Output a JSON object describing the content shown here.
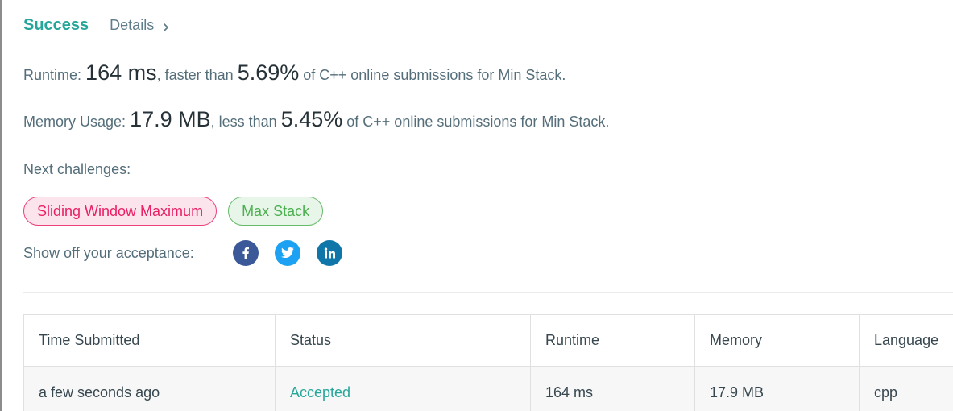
{
  "header": {
    "status_title": "Success",
    "details_label": "Details",
    "details_icon": "chevron-right-icon"
  },
  "runtime": {
    "label": "Runtime:",
    "value": "164 ms",
    "comparison": ", faster than",
    "percent": "5.69%",
    "suffix": "of C++ online submissions for Min Stack."
  },
  "memory": {
    "label": "Memory Usage:",
    "value": "17.9 MB",
    "comparison": ", less than",
    "percent": "5.45%",
    "suffix": "of C++ online submissions for Min Stack."
  },
  "next_challenges": {
    "label": "Next challenges:",
    "items": [
      {
        "label": "Sliding Window Maximum",
        "difficulty": "hard",
        "color": "#e91e63"
      },
      {
        "label": "Max Stack",
        "difficulty": "easy",
        "color": "#4caf50"
      }
    ]
  },
  "share": {
    "label": "Show off your acceptance:",
    "icons": [
      "facebook-icon",
      "twitter-icon",
      "linkedin-icon"
    ],
    "colors": {
      "facebook": "#3b5998",
      "twitter": "#1da1f2",
      "linkedin": "#0e76a8"
    }
  },
  "submissions_table": {
    "columns": [
      "Time Submitted",
      "Status",
      "Runtime",
      "Memory",
      "Language"
    ],
    "rows": [
      {
        "time": "a few seconds ago",
        "status": "Accepted",
        "runtime": "164 ms",
        "memory": "17.9 MB",
        "language": "cpp"
      }
    ]
  },
  "colors": {
    "accent": "#26a69a",
    "text": "#546e7a"
  }
}
